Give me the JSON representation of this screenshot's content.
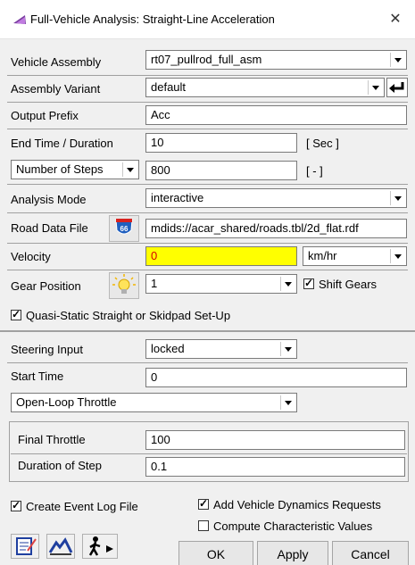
{
  "window": {
    "title": "Full-Vehicle Analysis: Straight-Line Acceleration",
    "close_symbol": "✕"
  },
  "form": {
    "vehicle_assembly": {
      "label": "Vehicle Assembly",
      "value": "rt07_pullrod_full_asm"
    },
    "assembly_variant": {
      "label": "Assembly Variant",
      "value": "default"
    },
    "output_prefix": {
      "label": "Output Prefix",
      "value": "Acc"
    },
    "end_time": {
      "label": "End Time / Duration",
      "value": "10",
      "units": "[ Sec ]"
    },
    "steps": {
      "selector": "Number of Steps",
      "value": "800",
      "units": "[ - ]"
    },
    "analysis_mode": {
      "label": "Analysis Mode",
      "value": "interactive"
    },
    "road_data": {
      "label": "Road Data File",
      "value": "mdids://acar_shared/roads.tbl/2d_flat.rdf",
      "icon_text": "66"
    },
    "velocity": {
      "label": "Velocity",
      "value": "0",
      "units": "km/hr"
    },
    "gear_position": {
      "label": "Gear Position",
      "value": "1",
      "shift_label": "Shift Gears",
      "shift_checked": true
    },
    "quasi_static": {
      "label": "Quasi-Static Straight or Skidpad Set-Up",
      "checked": true
    },
    "steering_input": {
      "label": "Steering Input",
      "value": "locked"
    },
    "start_time": {
      "label": "Start Time",
      "value": "0"
    },
    "throttle_mode": {
      "value": "Open-Loop Throttle"
    },
    "final_throttle": {
      "label": "Final Throttle",
      "value": "100"
    },
    "duration_of_step": {
      "label": "Duration of Step",
      "value": "0.1"
    }
  },
  "footer": {
    "create_event_log": {
      "label": "Create Event Log File",
      "checked": true
    },
    "add_vdr": {
      "label": "Add Vehicle Dynamics Requests",
      "checked": true
    },
    "compute_char": {
      "label": "Compute Characteristic Values",
      "checked": false
    },
    "ok_label": "OK",
    "apply_label": "Apply",
    "cancel_label": "Cancel"
  },
  "colors": {
    "velocity_bg": "#ffff00",
    "velocity_text": "#d60000",
    "accent": "#1f5fbf"
  },
  "icons": [
    "vehicle-icon",
    "road-sign-icon",
    "lightbulb-icon",
    "notepad-icon",
    "measure-icon",
    "pedestrian-icon",
    "return-icon"
  ]
}
